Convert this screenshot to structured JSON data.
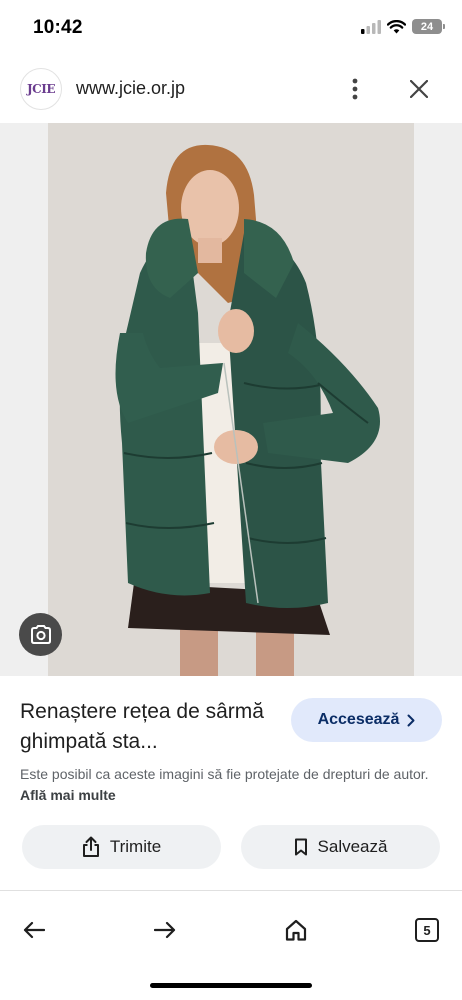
{
  "status_bar": {
    "time": "10:42",
    "battery_level": "24",
    "icons": [
      "signal-icon",
      "wifi-icon",
      "battery-icon"
    ]
  },
  "site": {
    "logo_text": "JCIE",
    "url": "www.jcie.or.jp"
  },
  "result": {
    "title": "Renaștere rețea de sârmă ghimpată sta...",
    "visit_label": "Accesează",
    "disclaimer": "Este posibil ca aceste imagini să fie protejate de drepturi de autor.",
    "learn_more": "Află mai multe"
  },
  "actions": {
    "share_label": "Trimite",
    "save_label": "Salvează"
  },
  "bottom_nav": {
    "tab_count": "5"
  },
  "colors": {
    "accent_button": "#e1e9fb",
    "accent_text": "#0b2d66",
    "action_button": "#eff1f3",
    "jacket_green": "#2f5a4b"
  }
}
